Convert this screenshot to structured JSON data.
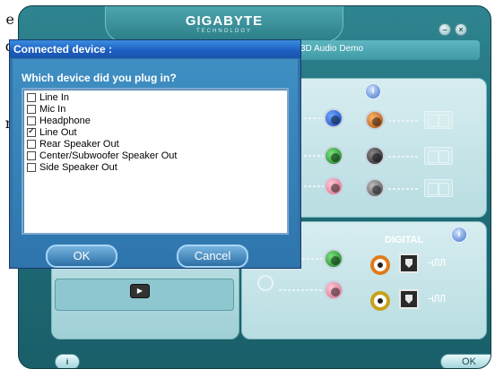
{
  "page_fragment": [
    "e",
    "d",
    ".",
    "n",
    "-"
  ],
  "app": {
    "logo": "GIGABYTE",
    "logo_sub": "TECHNOLOGY",
    "tab_3d": "3D Audio Demo",
    "digital_label": "DIGITAL",
    "ok_label": "OK",
    "minimize_glyph": "–",
    "close_glyph": "×",
    "info_glyph": "i"
  },
  "dialog": {
    "title": "Connected device :",
    "question": "Which device did you plug in?",
    "options": [
      {
        "label": "Line In",
        "checked": false
      },
      {
        "label": "Mic In",
        "checked": false
      },
      {
        "label": "Headphone",
        "checked": false
      },
      {
        "label": "Line Out",
        "checked": true
      },
      {
        "label": "Rear Speaker Out",
        "checked": false
      },
      {
        "label": "Center/Subwoofer Speaker Out",
        "checked": false
      },
      {
        "label": "Side Speaker Out",
        "checked": false
      }
    ],
    "ok_label": "OK",
    "cancel_label": "Cancel"
  },
  "colors": {
    "app_teal": "#1f6d78",
    "dialog_title_blue": "#1c5dbf",
    "dialog_body_blue": "#3f8fc3"
  }
}
